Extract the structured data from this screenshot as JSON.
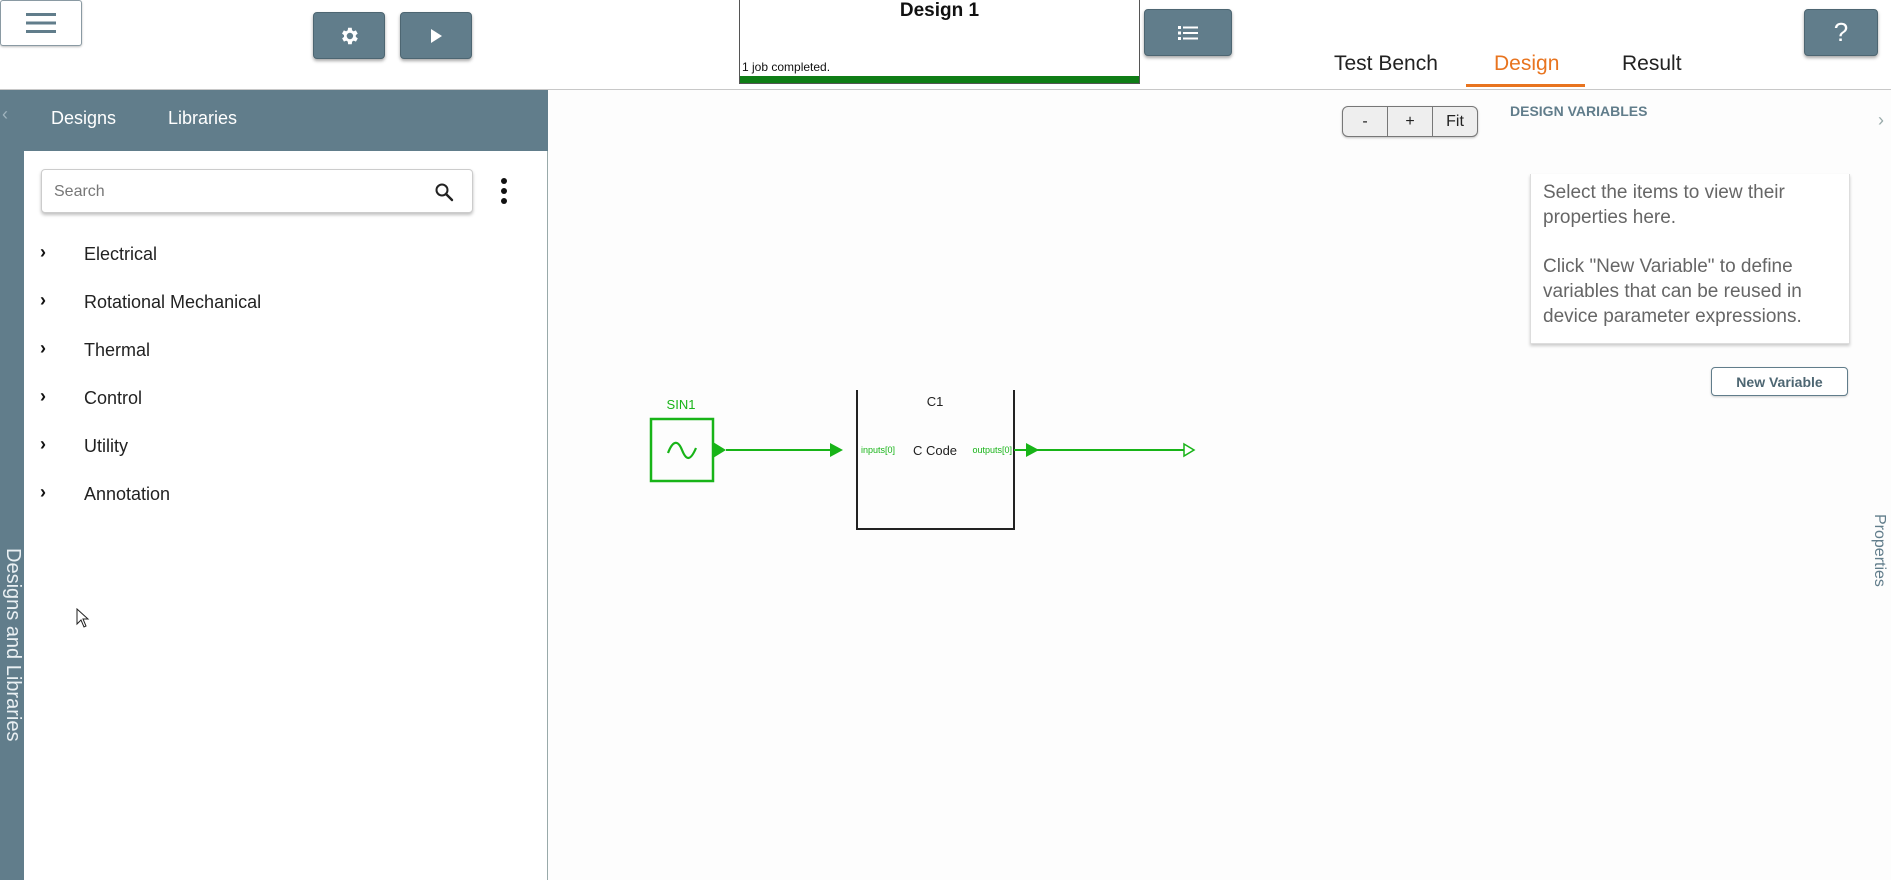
{
  "toolbar": {
    "menu_icon": "hamburger-icon",
    "settings_icon": "gear-icon",
    "run_icon": "play-icon",
    "list_icon": "list-icon",
    "help_label": "?"
  },
  "design_panel": {
    "title": "Design 1",
    "status": "1 job completed.",
    "progress": 1.0
  },
  "tabs": [
    {
      "label": "Test Bench",
      "active": false
    },
    {
      "label": "Design",
      "active": true
    },
    {
      "label": "Result",
      "active": false
    }
  ],
  "left_strip": {
    "label": "Designs and Libraries"
  },
  "library": {
    "tabs": [
      "Designs",
      "Libraries"
    ],
    "search": {
      "placeholder": "Search",
      "value": ""
    },
    "tree": [
      {
        "label": "Electrical"
      },
      {
        "label": "Rotational Mechanical"
      },
      {
        "label": "Thermal"
      },
      {
        "label": "Control"
      },
      {
        "label": "Utility"
      },
      {
        "label": "Annotation"
      }
    ]
  },
  "canvas": {
    "zoom": {
      "minus": "-",
      "plus": "+",
      "fit": "Fit"
    },
    "source_block": {
      "name": "SIN1"
    },
    "code_block": {
      "name": "C1",
      "label": "C Code",
      "input_port": "inputs[0]",
      "output_port": "outputs[0]"
    }
  },
  "design_variables": {
    "title": "DESIGN VARIABLES",
    "info_line1": "Select the items to view their properties here.",
    "info_line2": "Click \"New Variable\" to define variables that can be reused in device parameter expressions.",
    "new_variable_label": "New Variable"
  },
  "properties_label": "Properties",
  "colors": {
    "toolbar_button": "#617d8b",
    "active_tab": "#e8741f",
    "progress": "#0f7d16",
    "wire": "#18b418"
  }
}
